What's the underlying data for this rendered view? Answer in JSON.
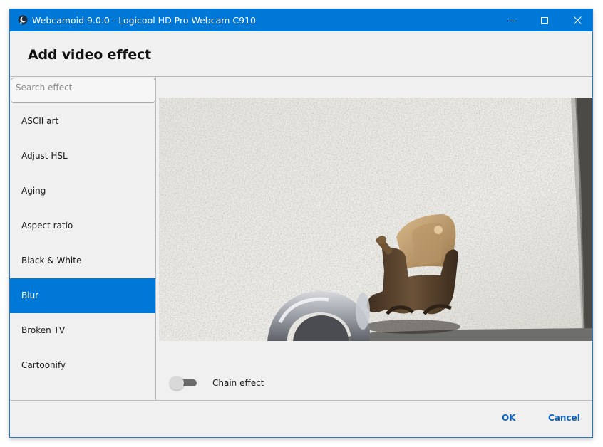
{
  "window": {
    "title": "Webcamoid 9.0.0 - Logicool HD Pro Webcam C910",
    "icon": "webcamoid-app-icon",
    "controls": [
      "minimize-icon",
      "maximize-icon",
      "close-icon"
    ]
  },
  "header": {
    "title": "Add video effect"
  },
  "sidebar": {
    "search": {
      "placeholder": "Search effect",
      "value": ""
    },
    "items": [
      {
        "label": "ASCII art"
      },
      {
        "label": "Adjust HSL"
      },
      {
        "label": "Aging"
      },
      {
        "label": "Aspect ratio"
      },
      {
        "label": "Black & White"
      },
      {
        "label": "Blur",
        "selected": true
      },
      {
        "label": "Broken TV"
      },
      {
        "label": "Cartoonify"
      }
    ]
  },
  "chain": {
    "label": "Chain effect",
    "enabled": false
  },
  "footer": {
    "ok_label": "OK",
    "cancel_label": "Cancel"
  },
  "colors": {
    "accent": "#0078d7",
    "background": "#f0f0f0",
    "link_button": "#0a64c4"
  }
}
